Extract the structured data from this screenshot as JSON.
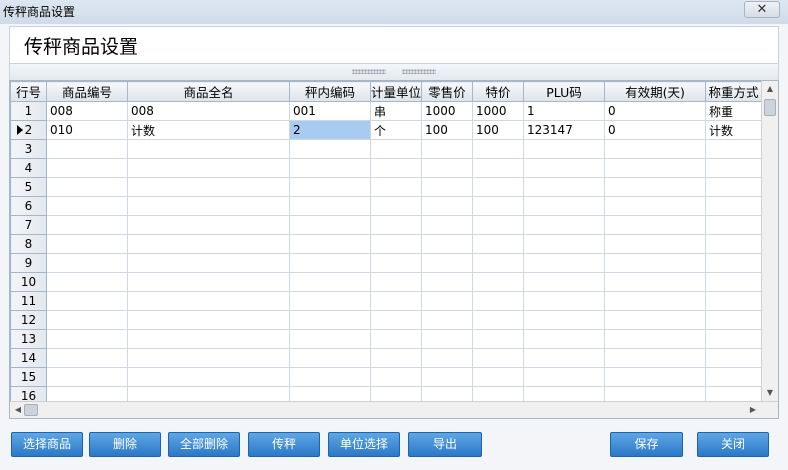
{
  "window": {
    "title": "传秤商品设置",
    "heading": "传秤商品设置",
    "close_symbol": "✕"
  },
  "grid": {
    "columns": [
      "行号",
      "商品编号",
      "商品全名",
      "秤内编码",
      "计量单位",
      "零售价",
      "特价",
      "PLU码",
      "有效期(天)",
      "称重方式"
    ],
    "rows": [
      {
        "no": "1",
        "code": "008",
        "name": "008",
        "scale_code": "001",
        "unit": "串",
        "retail": "1000",
        "special": "1000",
        "plu": "1",
        "expiry": "0",
        "weigh": "称重"
      },
      {
        "no": "2",
        "code": "010",
        "name": "计数",
        "scale_code": "2",
        "unit": "个",
        "retail": "100",
        "special": "100",
        "plu": "123147",
        "expiry": "0",
        "weigh": "计数"
      },
      {
        "no": "3"
      },
      {
        "no": "4"
      },
      {
        "no": "5"
      },
      {
        "no": "6"
      },
      {
        "no": "7"
      },
      {
        "no": "8"
      },
      {
        "no": "9"
      },
      {
        "no": "10"
      },
      {
        "no": "11"
      },
      {
        "no": "12"
      },
      {
        "no": "13"
      },
      {
        "no": "14"
      },
      {
        "no": "15"
      },
      {
        "no": "16"
      }
    ],
    "current_row": 2,
    "selected_column": "scale_code"
  },
  "buttons": {
    "select_goods": "选择商品",
    "delete": "删除",
    "delete_all": "全部删除",
    "send_scale": "传秤",
    "unit_select": "单位选择",
    "export": "导出",
    "save": "保存",
    "close": "关闭"
  },
  "colors": {
    "button_top": "#5fa6e3",
    "button_bottom": "#2a78c8",
    "selected_cell": "#a8cbf2"
  }
}
